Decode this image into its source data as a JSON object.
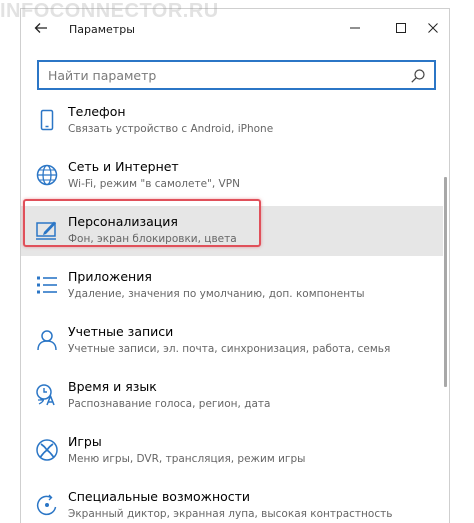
{
  "watermark": "INFOCONNECTOR.RU",
  "window": {
    "title": "Параметры"
  },
  "search": {
    "placeholder": "Найти параметр"
  },
  "items": [
    {
      "label": "Телефон",
      "sub": "Связать устройство с Android, iPhone",
      "icon": "phone-icon"
    },
    {
      "label": "Сеть и Интернет",
      "sub": "Wi-Fi, режим \"в самолете\", VPN",
      "icon": "globe-icon"
    },
    {
      "label": "Персонализация",
      "sub": "Фон, экран блокировки, цвета",
      "icon": "personalization-icon",
      "selected": true
    },
    {
      "label": "Приложения",
      "sub": "Удаление, значения по умолчанию, доп. компоненты",
      "icon": "apps-list-icon"
    },
    {
      "label": "Учетные записи",
      "sub": "Учетные записи, эл. почта, синхронизация, работа, семья",
      "icon": "person-icon"
    },
    {
      "label": "Время и язык",
      "sub": "Распознавание голоса, регион, дата",
      "icon": "time-language-icon"
    },
    {
      "label": "Игры",
      "sub": "Меню игры, DVR, трансляция, режим игры",
      "icon": "xbox-icon"
    },
    {
      "label": "Специальные возможности",
      "sub": "Экранный диктор, экранная лупа, высокая контрастность",
      "icon": "accessibility-icon"
    }
  ],
  "colors": {
    "accent": "#2b76c6",
    "selected_bg": "#e6e6e6",
    "highlight_border": "#e0505a"
  }
}
